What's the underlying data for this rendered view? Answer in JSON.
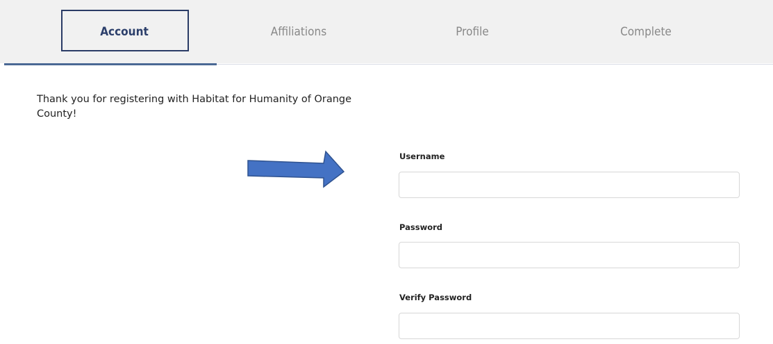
{
  "tabs": {
    "account": "Account",
    "affiliations": "Affiliations",
    "profile": "Profile",
    "complete": "Complete",
    "active": "Account"
  },
  "intro": {
    "message": "Thank you for registering with Habitat for Humanity of Orange County!"
  },
  "form": {
    "username_label": "Username",
    "username_value": "",
    "password_label": "Password",
    "password_value": "",
    "verify_password_label": "Verify Password",
    "verify_password_value": ""
  },
  "colors": {
    "active_tab_text": "#2c3f6b",
    "inactive_tab_text": "#888888",
    "highlight_box": "#2a3b66",
    "active_underline": "#4a6894",
    "arrow_fill": "#4472c4",
    "arrow_stroke": "#2f528f"
  },
  "annotations": {
    "arrow_icon": "right-arrow-icon"
  }
}
